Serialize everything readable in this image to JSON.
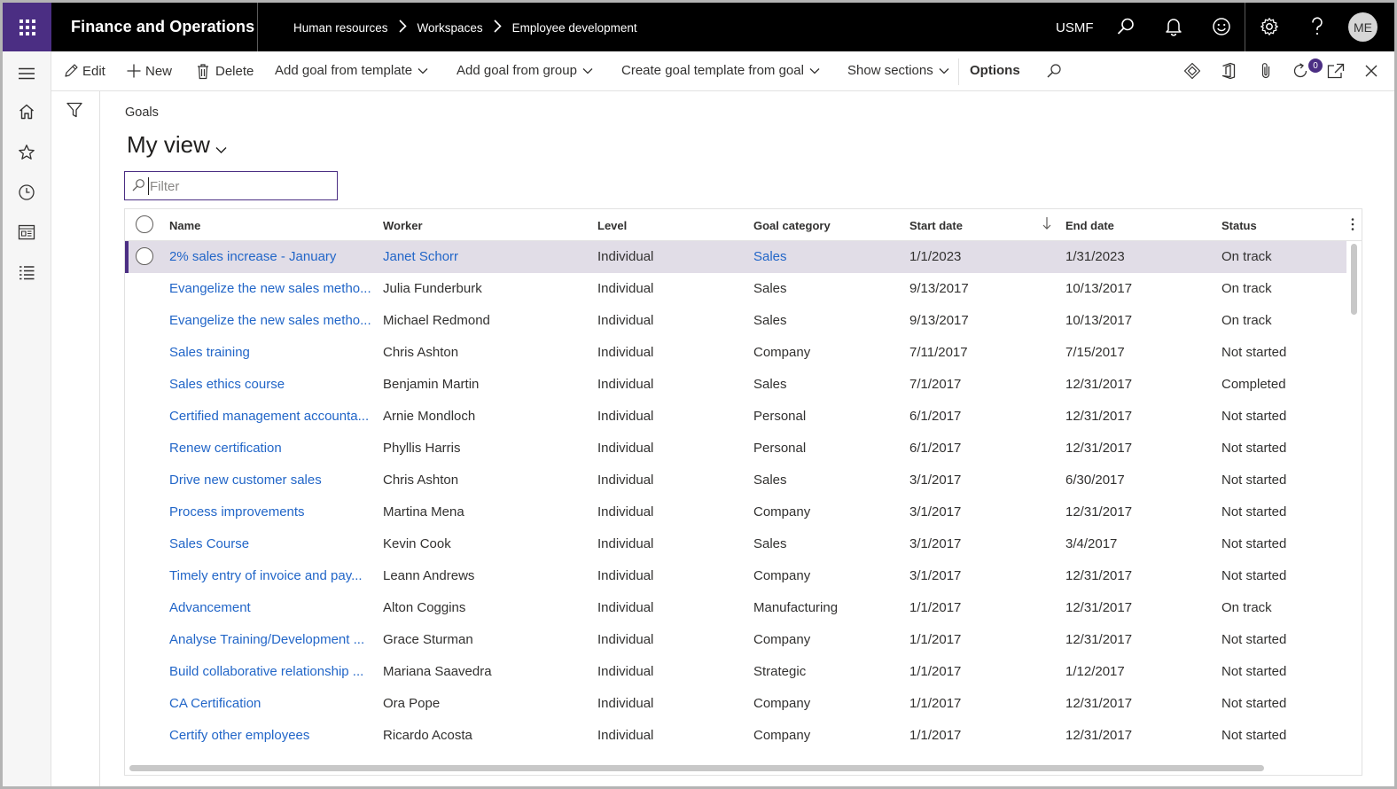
{
  "app": {
    "title": "Finance and Operations"
  },
  "breadcrumb": [
    "Human resources",
    "Workspaces",
    "Employee development"
  ],
  "header": {
    "company": "USMF",
    "user_initials": "ME"
  },
  "icons": {
    "top": [
      "search-icon",
      "bell-icon",
      "smiley-icon",
      "gear-icon",
      "help-icon"
    ],
    "nav": [
      "hamburger-icon",
      "home-icon",
      "star-icon",
      "clock-icon",
      "workspace-icon",
      "modules-icon"
    ],
    "actions_right": [
      "diamond-icon",
      "office-icon",
      "attachment-icon",
      "refresh-icon",
      "popout-icon",
      "close-icon"
    ]
  },
  "toolbar": {
    "edit": "Edit",
    "new": "New",
    "delete": "Delete",
    "add_from_template": "Add goal from template",
    "add_from_group": "Add goal from group",
    "create_template": "Create goal template from goal",
    "show_sections": "Show sections",
    "options": "Options",
    "attachments_count": "0"
  },
  "page": {
    "label": "Goals",
    "view": "My view"
  },
  "filter": {
    "placeholder": "Filter"
  },
  "table": {
    "columns": [
      "Name",
      "Worker",
      "Level",
      "Goal category",
      "Start date",
      "End date",
      "Status"
    ],
    "sorted_column": "Start date",
    "sort_direction": "descending",
    "rows": [
      [
        "2% sales increase - January",
        "Janet Schorr",
        "Individual",
        "Sales",
        "1/1/2023",
        "1/31/2023",
        "On track"
      ],
      [
        "Evangelize the new sales metho...",
        "Julia Funderburk",
        "Individual",
        "Sales",
        "9/13/2017",
        "10/13/2017",
        "On track"
      ],
      [
        "Evangelize the new sales metho...",
        "Michael Redmond",
        "Individual",
        "Sales",
        "9/13/2017",
        "10/13/2017",
        "On track"
      ],
      [
        "Sales training",
        "Chris Ashton",
        "Individual",
        "Company",
        "7/11/2017",
        "7/15/2017",
        "Not started"
      ],
      [
        "Sales ethics course",
        "Benjamin Martin",
        "Individual",
        "Sales",
        "7/1/2017",
        "12/31/2017",
        "Completed"
      ],
      [
        "Certified management accounta...",
        "Arnie Mondloch",
        "Individual",
        "Personal",
        "6/1/2017",
        "12/31/2017",
        "Not started"
      ],
      [
        "Renew certification",
        "Phyllis Harris",
        "Individual",
        "Personal",
        "6/1/2017",
        "12/31/2017",
        "Not started"
      ],
      [
        "Drive new customer sales",
        "Chris Ashton",
        "Individual",
        "Sales",
        "3/1/2017",
        "6/30/2017",
        "Not started"
      ],
      [
        "Process improvements",
        "Martina Mena",
        "Individual",
        "Company",
        "3/1/2017",
        "12/31/2017",
        "Not started"
      ],
      [
        "Sales Course",
        "Kevin Cook",
        "Individual",
        "Sales",
        "3/1/2017",
        "3/4/2017",
        "Not started"
      ],
      [
        "Timely entry of invoice and pay...",
        "Leann Andrews",
        "Individual",
        "Company",
        "3/1/2017",
        "12/31/2017",
        "Not started"
      ],
      [
        "Advancement",
        "Alton Coggins",
        "Individual",
        "Manufacturing",
        "1/1/2017",
        "12/31/2017",
        "On track"
      ],
      [
        "Analyse Training/Development ...",
        "Grace Sturman",
        "Individual",
        "Company",
        "1/1/2017",
        "12/31/2017",
        "Not started"
      ],
      [
        "Build collaborative relationship ...",
        "Mariana Saavedra",
        "Individual",
        "Strategic",
        "1/1/2017",
        "1/12/2017",
        "Not started"
      ],
      [
        "CA Certification",
        "Ora Pope",
        "Individual",
        "Company",
        "1/1/2017",
        "12/31/2017",
        "Not started"
      ],
      [
        "Certify other employees",
        "Ricardo Acosta",
        "Individual",
        "Company",
        "1/1/2017",
        "12/31/2017",
        "Not started"
      ]
    ]
  },
  "colors": {
    "accent": "#4b2e83",
    "link": "#2266c8",
    "selected_row": "#e1dde7"
  }
}
